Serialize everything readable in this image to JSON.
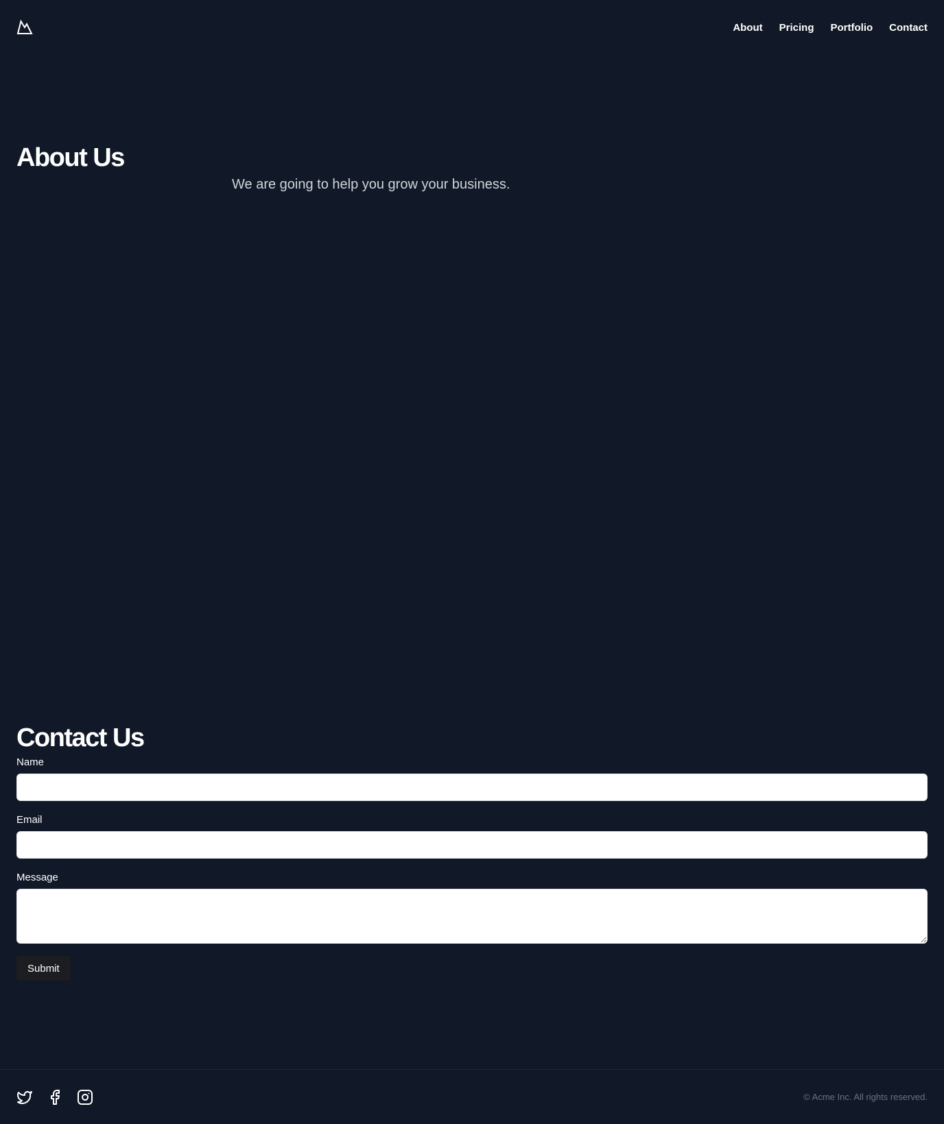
{
  "header": {
    "logo_icon": "mountain-icon",
    "nav": [
      {
        "label": "About"
      },
      {
        "label": "Pricing"
      },
      {
        "label": "Portfolio"
      },
      {
        "label": "Contact"
      }
    ]
  },
  "about": {
    "title": "About Us",
    "text": "We are going to help you grow your business."
  },
  "contact": {
    "title": "Contact Us",
    "name_label": "Name",
    "name_value": "",
    "email_label": "Email",
    "email_value": "",
    "message_label": "Message",
    "message_value": "",
    "submit_label": "Submit"
  },
  "footer": {
    "socials": [
      "twitter-icon",
      "facebook-icon",
      "instagram-icon"
    ],
    "copyright": "© Acme Inc. All rights reserved."
  },
  "colors": {
    "background": "#111827",
    "text": "#ffffff",
    "muted": "#6b7280",
    "button": "#1c1d20"
  }
}
